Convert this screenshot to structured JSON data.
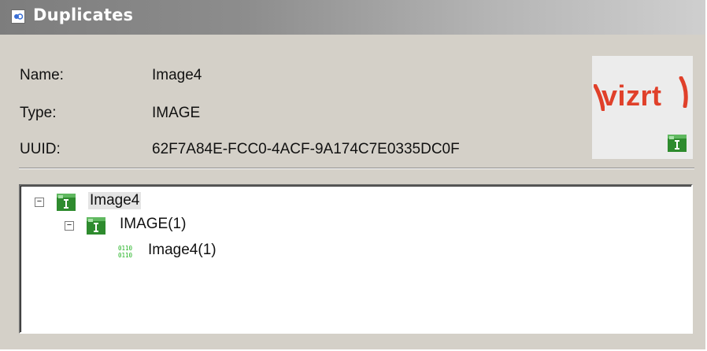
{
  "window": {
    "title": "Duplicates",
    "title_icon": "window-app-icon"
  },
  "info": {
    "name_label": "Name:",
    "name_value": "Image4",
    "type_label": "Type:",
    "type_value": "IMAGE",
    "uuid_label": "UUID:",
    "uuid_value": "62F7A84E-FCC0-4ACF-9A174C7E0335DC0F"
  },
  "thumbnail": {
    "logo_text": "vizrt",
    "logo_color": "#e0402a",
    "badge_icon": "image-type-icon"
  },
  "tree": {
    "nodes": [
      {
        "label": "Image4",
        "icon": "image-type-icon",
        "expander": "⊟",
        "selected": true
      },
      {
        "label": "IMAGE(1)",
        "icon": "image-type-icon",
        "expander": "⊟",
        "selected": false
      },
      {
        "label": "Image4(1)",
        "icon": "binary-data-icon",
        "expander": "",
        "selected": false
      }
    ]
  },
  "colors": {
    "titlebar_start": "#7d7d7d",
    "panel_bg": "#d4d0c8",
    "image_icon_green": "#2e8b2e"
  }
}
